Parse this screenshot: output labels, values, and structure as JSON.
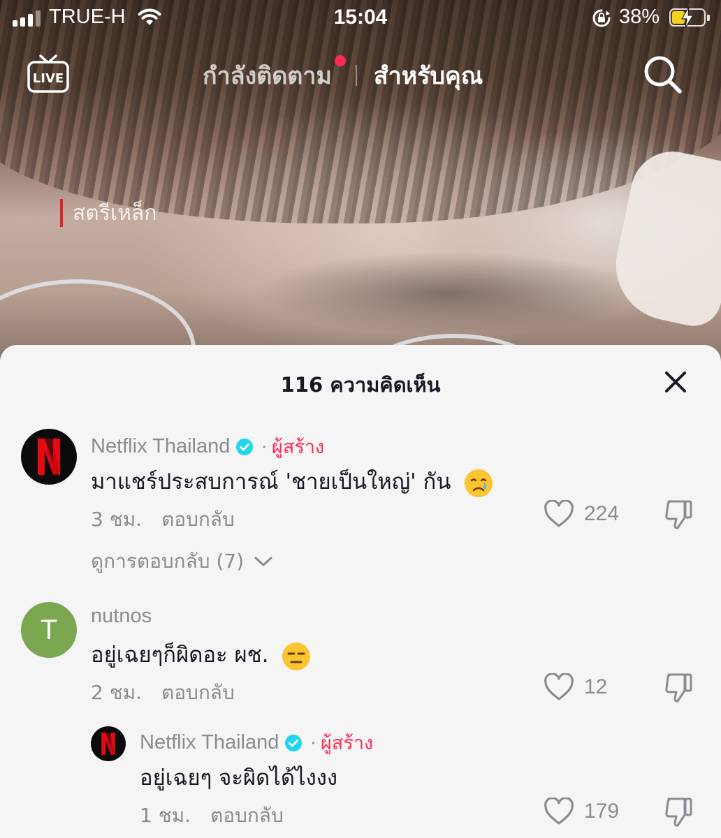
{
  "status_bar": {
    "carrier": "TRUE-H",
    "time": "15:04",
    "battery_percent": "38%",
    "battery_level": 0.38
  },
  "video": {
    "overlay_tag": "สตรีเหล็ก"
  },
  "top_nav": {
    "live_label": "LIVE",
    "tabs": [
      {
        "label": "กำลังติดตาม",
        "active": false,
        "has_dot": true
      },
      {
        "label": "สำหรับคุณ",
        "active": true
      }
    ]
  },
  "comments_panel": {
    "title": "116 ความคิดเห็น",
    "comments": [
      {
        "username": "Netflix Thailand",
        "verified": true,
        "creator_label": "ผู้สร้าง",
        "separator": "·",
        "text": "มาแชร์ประสบการณ์ 'ชายเป็นใหญ่' กัน",
        "emoji": "crying-face",
        "time": "3 ชม.",
        "reply_label": "ตอบกลับ",
        "likes": "224",
        "view_replies": "ดูการตอบกลับ (7)"
      },
      {
        "username": "nutnos",
        "avatar_initial": "T",
        "text": "อยู่เฉยๆก็ผิดอะ ผช.",
        "emoji": "expressionless-face",
        "time": "2 ชม.",
        "reply_label": "ตอบกลับ",
        "likes": "12"
      },
      {
        "username": "Netflix Thailand",
        "verified": true,
        "creator_label": "ผู้สร้าง",
        "separator": "·",
        "text": "อยู่เฉยๆ จะผิดได้ไงงง",
        "time": "1 ชม.",
        "reply_label": "ตอบกลับ",
        "likes": "179"
      }
    ]
  },
  "colors": {
    "accent": "#fe2c55",
    "verified": "#20d5ec",
    "netflix_red": "#e50914",
    "avatar_green": "#7aa74f",
    "sheet_bg": "#f5f5f6"
  }
}
